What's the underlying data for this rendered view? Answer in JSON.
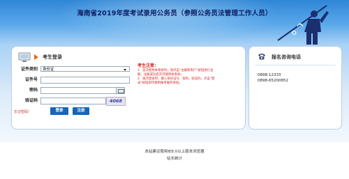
{
  "banner": {
    "title": "海南省2019年度考试录用公务员（参照公务员法管理工作人员）"
  },
  "login": {
    "title": "考生登录",
    "id_type_label": "证件类别",
    "id_type_value": "身份证",
    "id_number_label": "证件号",
    "password_label": "密码",
    "captcha_label": "验证码",
    "captcha_text": "4068",
    "forgot_label": "忘记密码!",
    "login_button": "登录",
    "register_button": "注册"
  },
  "notice": {
    "title": "考生注意：",
    "lines": [
      "1．首次使用本系统时，须点击“注册新用户”按钮进行注",
      "册，注册成功后方可使用本系统；",
      "2．再次登录时，输入身份证号、密码、验证码，点击“登",
      "录”按钮即可使用报考服务系统。"
    ]
  },
  "contact": {
    "title": "报名咨询电话",
    "phones": [
      "0898-12333",
      "0898-65200852"
    ]
  },
  "footer": {
    "line1": "本站建议使用IE8.0以上版本浏览器",
    "line2": "站长统计"
  },
  "colors": {
    "banner_top": "#2f86d6",
    "banner_title": "#0c1f63",
    "notice_red": "#d81e1e",
    "button_blue": "#1366b8"
  }
}
